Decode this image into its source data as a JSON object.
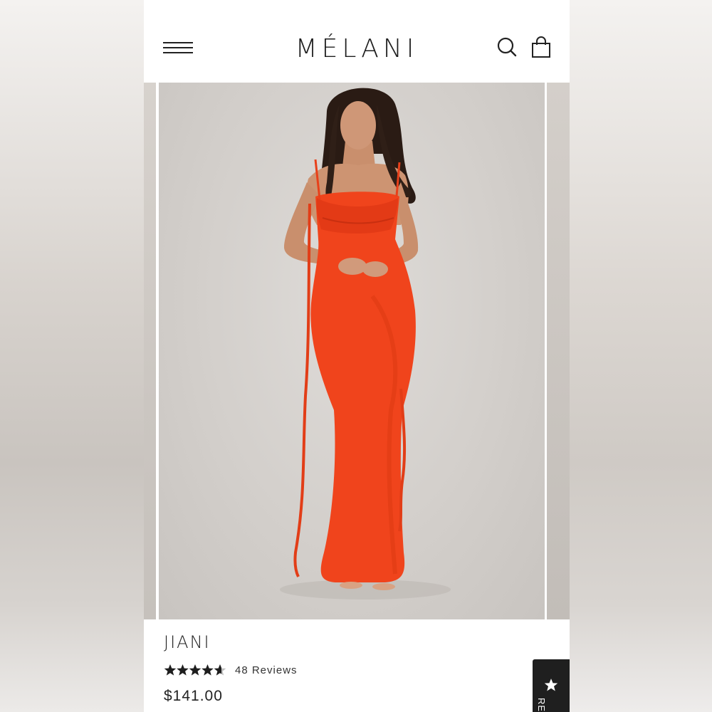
{
  "header": {
    "brand": "MÉLANI",
    "menu_icon": "hamburger-menu-icon",
    "search_icon": "search-icon",
    "cart_icon": "shopping-bag-icon"
  },
  "gallery": {
    "image_subject": "model wearing long red-orange cowl-neck maxi dress with tie straps"
  },
  "product": {
    "name": "JIANI",
    "rating": 4.5,
    "rating_max": 5,
    "reviews_label": "48 Reviews",
    "price": "$141.00"
  },
  "reviews_tab": {
    "label": "REVIEWS",
    "icon": "star-icon"
  },
  "colors": {
    "dress": "#f0441c",
    "text": "#222222",
    "tab_bg": "#1f1f1f"
  }
}
